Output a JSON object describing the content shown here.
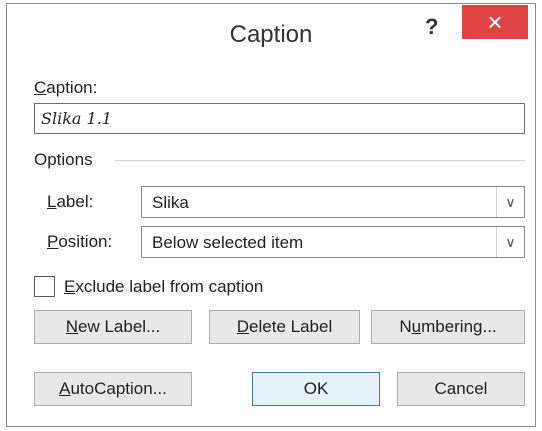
{
  "window": {
    "title": "Caption",
    "help_glyph": "?",
    "close_glyph": "×"
  },
  "caption": {
    "label": "Caption:",
    "value": "Slika 1.1"
  },
  "options": {
    "title": "Options",
    "label_field": {
      "label": "Label:",
      "value": "Slika",
      "arrow": "∨"
    },
    "position_field": {
      "label": "Position:",
      "value": "Below selected item",
      "arrow": "∨"
    }
  },
  "exclude_label": {
    "label": "Exclude label from caption",
    "checked": false
  },
  "buttons": {
    "new_label": "New Label...",
    "delete_label": "Delete Label",
    "numbering": "Numbering...",
    "autocaption": "AutoCaption...",
    "ok": "OK",
    "cancel": "Cancel"
  },
  "colors": {
    "close_button": "#e04343",
    "default_button_border": "#3c7fb1"
  }
}
